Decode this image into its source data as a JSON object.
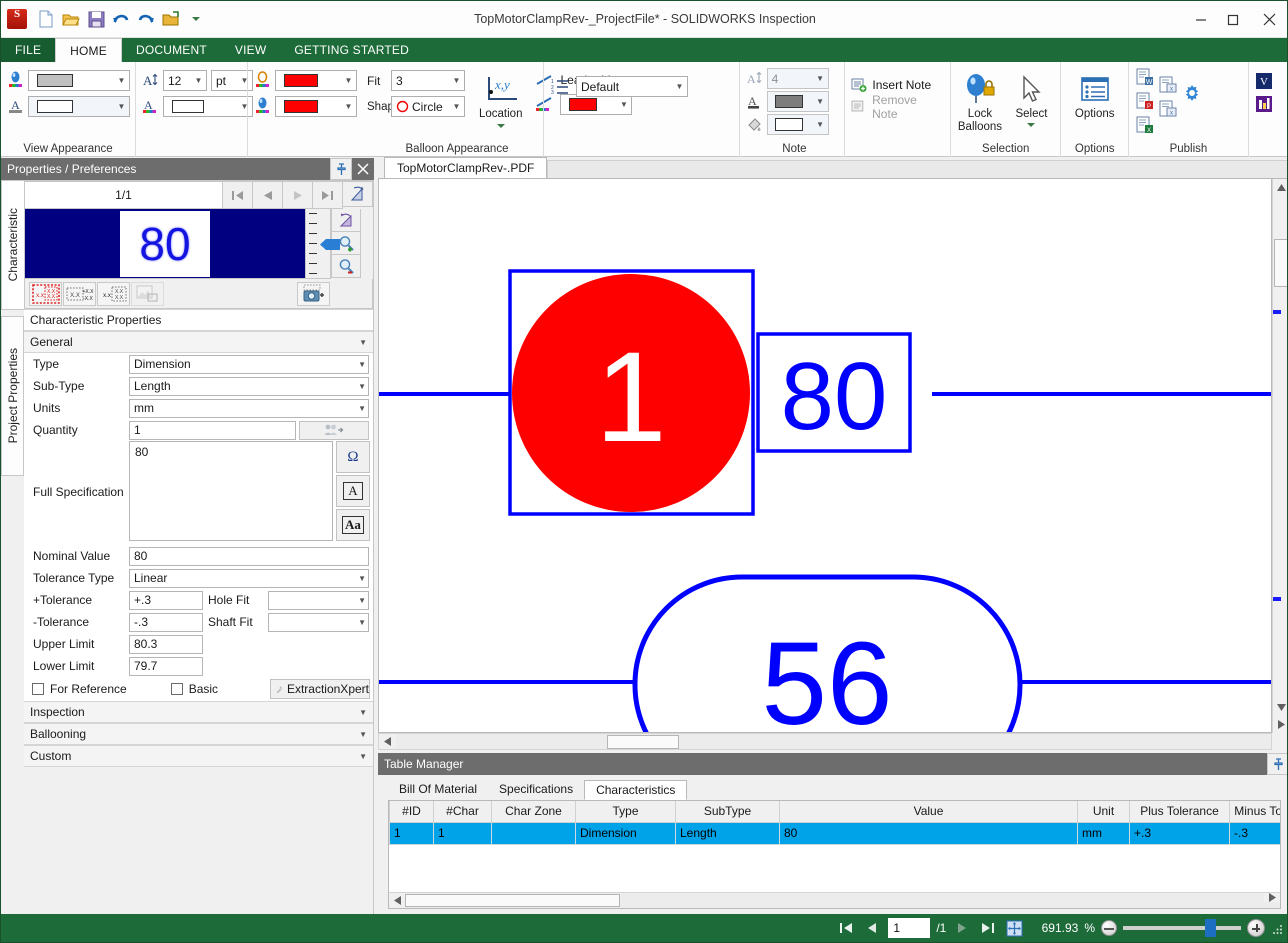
{
  "window": {
    "title": "TopMotorClampRev-_ProjectFile* - SOLIDWORKS Inspection",
    "app_icon": "solidworks-icon",
    "minimize": "–",
    "maximize": "❐",
    "close": "✕"
  },
  "quick_access": [
    {
      "name": "new-document",
      "label": "New"
    },
    {
      "name": "open-document",
      "label": "Open"
    },
    {
      "name": "save-document",
      "label": "Save"
    },
    {
      "name": "undo",
      "label": "Undo"
    },
    {
      "name": "redo",
      "label": "Redo"
    },
    {
      "name": "open-recent",
      "label": "Open Recent"
    },
    {
      "name": "customize-qat",
      "label": "Customize Quick Access Toolbar"
    }
  ],
  "ribbon": {
    "tabs": [
      {
        "label": "FILE",
        "state": "file"
      },
      {
        "label": "HOME",
        "state": "active"
      },
      {
        "label": "DOCUMENT",
        "state": "normal"
      },
      {
        "label": "VIEW",
        "state": "normal"
      },
      {
        "label": "GETTING STARTED",
        "state": "normal"
      }
    ],
    "groups": {
      "view_appearance": {
        "label": "View Appearance",
        "fill_color": "#c0c0c0",
        "line_color": "#ffffff"
      },
      "font": {
        "font_size": "12",
        "font_unit": "pt",
        "font_color": "#ffffff"
      },
      "balloon": {
        "label": "Balloon Appearance",
        "balloon_color": "#ff0000",
        "balloon_fill": "#ff0000",
        "fit_label": "Fit",
        "fit_value": "3",
        "shape_label": "Shape",
        "shape_value": "Circle",
        "location_label": "Location",
        "leader_label": "Leader Line",
        "leader_color": "#ff0000",
        "numbering_value": "Default"
      },
      "note": {
        "label": "Note",
        "note_size": "4",
        "note_color": "#7d7d7d",
        "note_fill": "#ffffff",
        "insert_note": "Insert Note",
        "remove_note": "Remove Note"
      },
      "selection": {
        "label": "Selection",
        "lock_balloons": "Lock\nBalloons",
        "lock_balloons_l1": "Lock",
        "lock_balloons_l2": "Balloons",
        "select": "Select"
      },
      "options": {
        "label": "Options",
        "options_button": "Options"
      },
      "publish": {
        "label": "Publish"
      }
    }
  },
  "left_panel": {
    "title": "Properties / Preferences",
    "vertical_tabs": [
      {
        "label": "Characteristic",
        "active": true
      },
      {
        "label": "Project Properties",
        "active": false
      }
    ],
    "nav": {
      "counter": "1/1",
      "first": "⏮",
      "prev": "◀",
      "next": "▶",
      "last": "⏭"
    },
    "preview": {
      "value": "80",
      "background": "#000080",
      "text_color": "#1414e0"
    },
    "mini_tools": [
      {
        "name": "extract-dimension-tool",
        "state": "active"
      },
      {
        "name": "extract-tolerance-tool",
        "state": "normal"
      },
      {
        "name": "extract-value-tool",
        "state": "normal"
      },
      {
        "name": "extract-image-tool",
        "state": "disabled"
      },
      {
        "name": "capture-snapshot-tool",
        "state": "normal"
      }
    ],
    "section_title": "Characteristic Properties",
    "general": {
      "label": "General",
      "rows": [
        {
          "label": "Type",
          "value": "Dimension",
          "kind": "select"
        },
        {
          "label": "Sub-Type",
          "value": "Length",
          "kind": "select"
        },
        {
          "label": "Units",
          "value": "mm",
          "kind": "select"
        },
        {
          "label": "Quantity",
          "value": "1",
          "kind": "text"
        }
      ],
      "full_specification_label": "Full Specification",
      "full_specification_value": "80",
      "spec_buttons": [
        {
          "name": "symbol-omega-button",
          "glyph": "Ω"
        },
        {
          "name": "font-format-button",
          "glyph": "A"
        },
        {
          "name": "case-format-button",
          "glyph": "Aa"
        }
      ],
      "nominal_value_label": "Nominal Value",
      "nominal_value": "80",
      "tolerance_type_label": "Tolerance Type",
      "tolerance_type": "Linear",
      "plus_tolerance_label": "+Tolerance",
      "plus_tolerance": "+.3",
      "minus_tolerance_label": "-Tolerance",
      "minus_tolerance": "-.3",
      "hole_fit_label": "Hole Fit",
      "hole_fit": "",
      "shaft_fit_label": "Shaft Fit",
      "shaft_fit": "",
      "upper_limit_label": "Upper Limit",
      "upper_limit": "80.3",
      "lower_limit_label": "Lower Limit",
      "lower_limit": "79.7",
      "for_reference_label": "For Reference",
      "basic_label": "Basic",
      "extraction_xpert_label": "ExtractionXpert"
    },
    "collapsed_sections": [
      {
        "label": "Inspection"
      },
      {
        "label": "Ballooning"
      },
      {
        "label": "Custom"
      }
    ]
  },
  "document": {
    "tab_label": "TopMotorClampRev-.PDF",
    "drawing": {
      "balloon_number": "1",
      "balloon_color": "#ff0000",
      "balloon_text_color": "#ffffff",
      "dimension_box_value": "80",
      "dimension_stadium_value": "56",
      "line_color": "#0000ff"
    }
  },
  "table_manager": {
    "title": "Table Manager",
    "tabs": [
      {
        "label": "Bill Of Material",
        "active": false
      },
      {
        "label": "Specifications",
        "active": false
      },
      {
        "label": "Characteristics",
        "active": true
      }
    ],
    "columns": [
      "#ID",
      "#Char",
      "Char Zone",
      "Type",
      "SubType",
      "Value",
      "Unit",
      "Plus Tolerance",
      "Minus Tol"
    ],
    "rows": [
      {
        "id": "1",
        "char": "1",
        "char_zone": "",
        "type": "Dimension",
        "subtype": "Length",
        "value": "80",
        "unit": "mm",
        "plus_tolerance": "+.3",
        "minus_tolerance": "-.3"
      }
    ],
    "row_highlight_color": "#00a2e8"
  },
  "status_bar": {
    "page_value": "1",
    "page_total": "/1",
    "zoom_percent": "691.93",
    "percent_sign": "%",
    "first_page": "⏮",
    "prev_page": "◀",
    "next_page": "▶",
    "last_page": "⏭",
    "fit_page": "fit-page-icon"
  }
}
